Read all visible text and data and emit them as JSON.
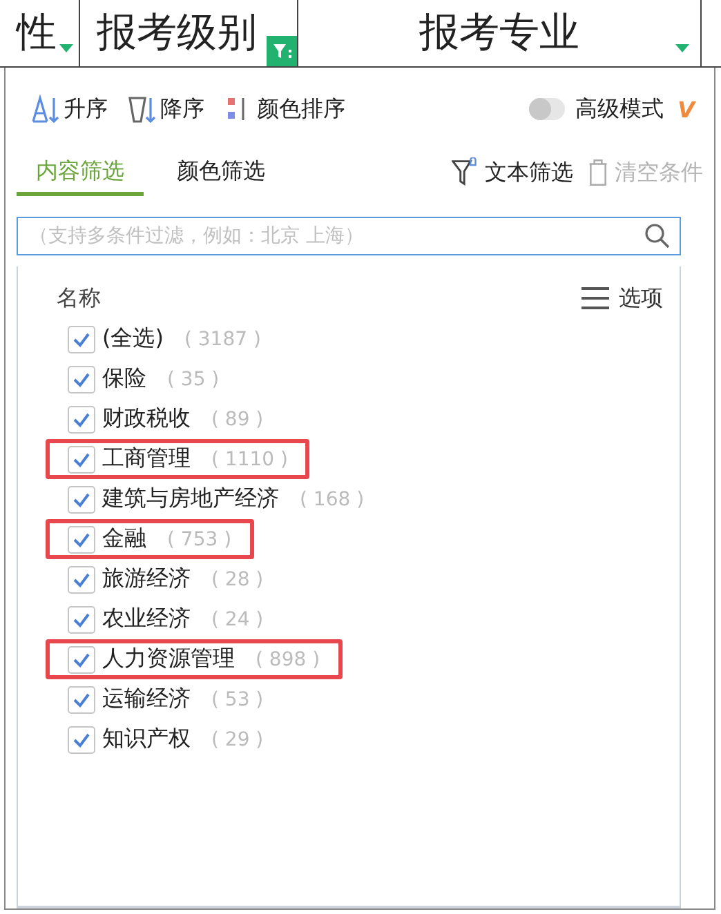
{
  "header_cells": [
    {
      "label": "性",
      "kind": "dropdown"
    },
    {
      "label": "报考级别",
      "kind": "filter"
    },
    {
      "label": "报考专业",
      "kind": "dropdown"
    }
  ],
  "toolbar": {
    "ascending": "升序",
    "descending": "降序",
    "color_sort": "颜色排序",
    "advanced_mode": {
      "label": "高级模式",
      "on": false,
      "badge": "V"
    }
  },
  "tabs": [
    {
      "label": "内容筛选",
      "selected": true
    },
    {
      "label": "颜色筛选",
      "selected": false
    }
  ],
  "text_filter": "文本筛选",
  "clear": {
    "label": "清空条件",
    "disabled": true
  },
  "search": {
    "placeholder": "（支持多条件过滤，例如：北京 上海）"
  },
  "list": {
    "heading": "名称",
    "options": "选项",
    "items": [
      {
        "label": "(全选)",
        "count": "( 3187 )",
        "checked": true,
        "highlighted": false
      },
      {
        "label": "保险",
        "count": "( 35 )",
        "checked": true,
        "highlighted": false
      },
      {
        "label": "财政税收",
        "count": "( 89 )",
        "checked": true,
        "highlighted": false
      },
      {
        "label": "工商管理",
        "count": "( 1110 )",
        "checked": true,
        "highlighted": true
      },
      {
        "label": "建筑与房地产经济",
        "count": "( 168 )",
        "checked": true,
        "highlighted": false
      },
      {
        "label": "金融",
        "count": "( 753 )",
        "checked": true,
        "highlighted": true
      },
      {
        "label": "旅游经济",
        "count": "( 28 )",
        "checked": true,
        "highlighted": false
      },
      {
        "label": "农业经济",
        "count": "( 24 )",
        "checked": true,
        "highlighted": false
      },
      {
        "label": "人力资源管理",
        "count": "( 898 )",
        "checked": true,
        "highlighted": true
      },
      {
        "label": "运输经济",
        "count": "( 53 )",
        "checked": true,
        "highlighted": false
      },
      {
        "label": "知识产权",
        "count": "( 29 )",
        "checked": true,
        "highlighted": false
      }
    ]
  }
}
